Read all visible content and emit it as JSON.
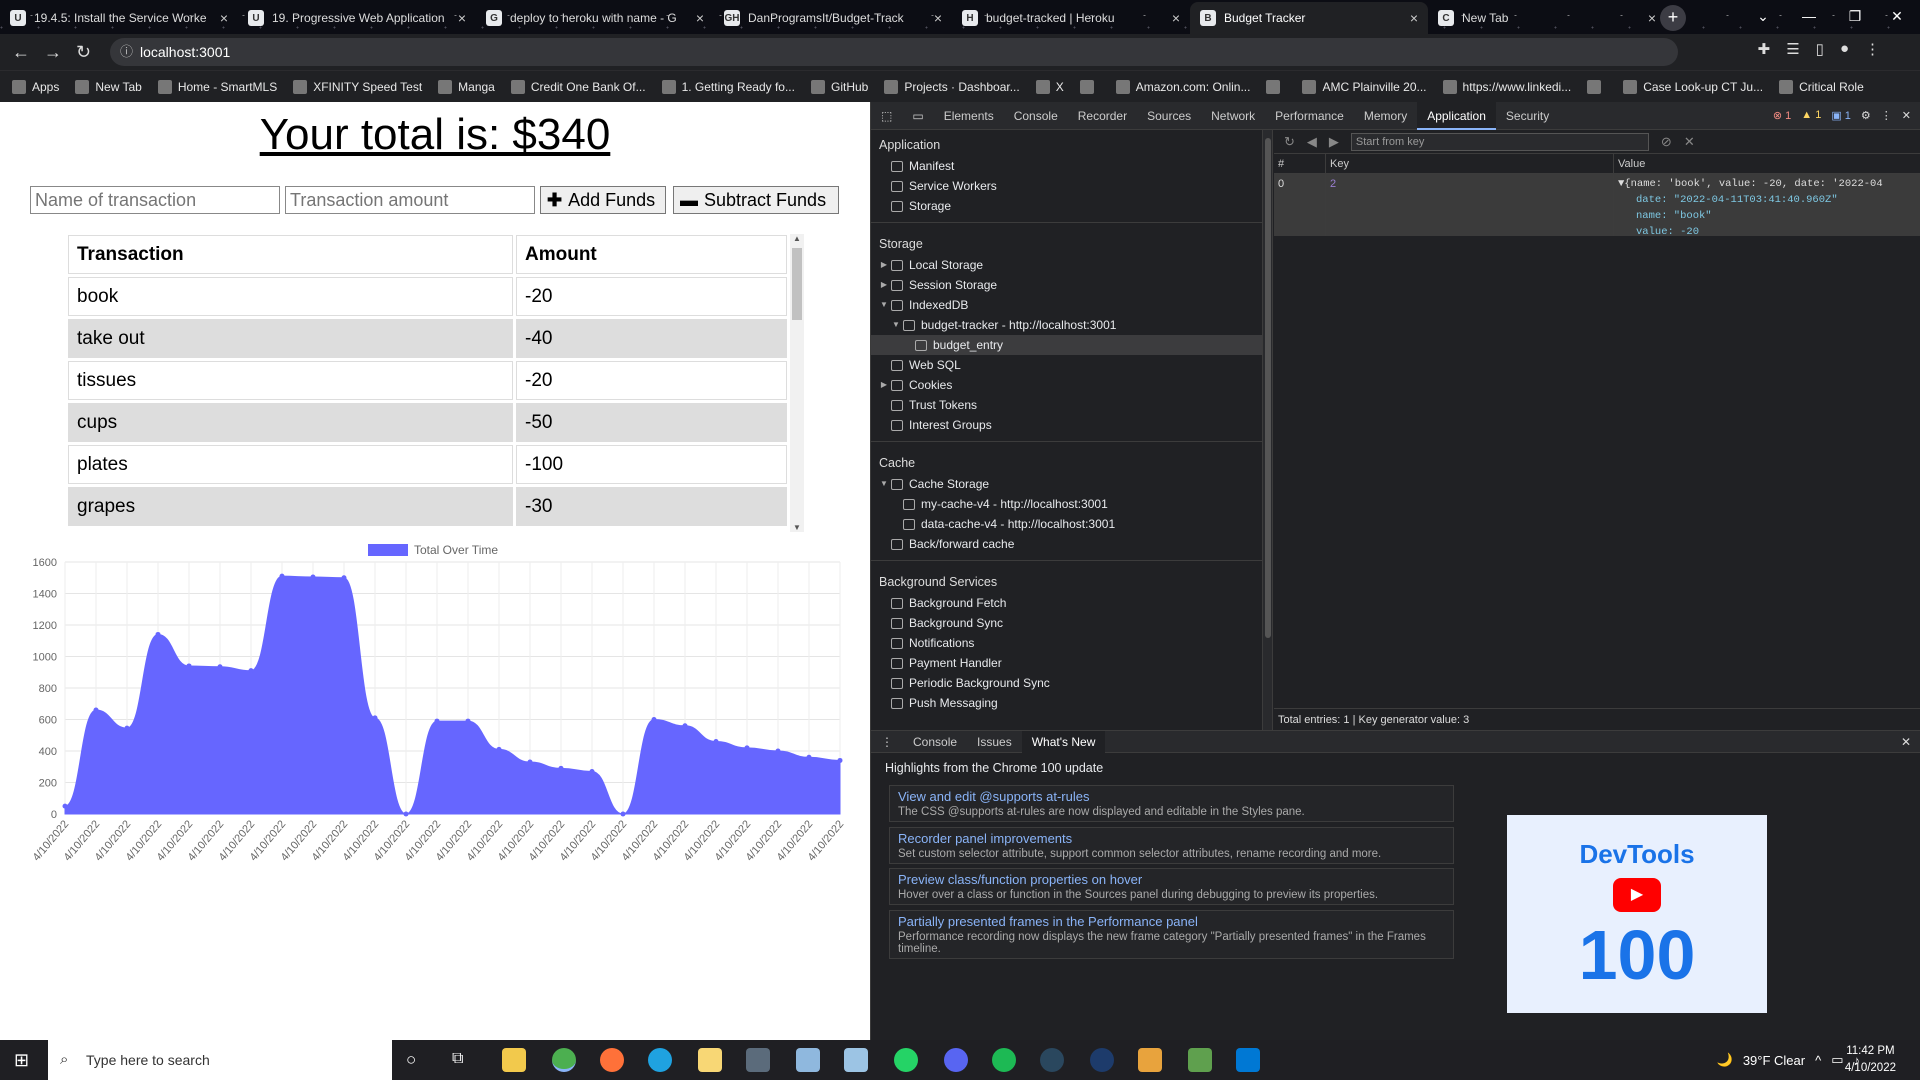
{
  "browser": {
    "tabs": [
      {
        "title": "19.4.5: Install the Service Worke",
        "icon": "U"
      },
      {
        "title": "19. Progressive Web Application",
        "icon": "U"
      },
      {
        "title": "deploy to heroku with name - G",
        "icon": "G"
      },
      {
        "title": "DanProgramsIt/Budget-Track",
        "icon": "GH"
      },
      {
        "title": "budget-tracked | Heroku",
        "icon": "H"
      },
      {
        "title": "Budget Tracker",
        "icon": "B"
      },
      {
        "title": "New Tab",
        "icon": "C"
      }
    ],
    "active_tab": 5,
    "url": "localhost:3001",
    "url_info_icon": "info-icon",
    "bookmarks": [
      "Apps",
      "New Tab",
      "Home - SmartMLS",
      "XFINITY Speed Test",
      "Manga",
      "Credit One Bank Of...",
      "1. Getting Ready fo...",
      "GitHub",
      "Projects · Dashboar...",
      "X",
      "",
      "Amazon.com: Onlin...",
      "",
      "AMC Plainville 20...",
      "https://www.linkedi...",
      "",
      "Case Look-up CT Ju...",
      "Critical Role"
    ]
  },
  "app": {
    "total_text": "Your total is: $340",
    "name_placeholder": "Name of transaction",
    "amount_placeholder": "Transaction amount",
    "add_label": "Add Funds",
    "subtract_label": "Subtract Funds",
    "table_headers": [
      "Transaction",
      "Amount"
    ],
    "transactions": [
      {
        "name": "book",
        "amount": "-20"
      },
      {
        "name": "take out",
        "amount": "-40"
      },
      {
        "name": "tissues",
        "amount": "-20"
      },
      {
        "name": "cups",
        "amount": "-50"
      },
      {
        "name": "plates",
        "amount": "-100"
      },
      {
        "name": "grapes",
        "amount": "-30"
      }
    ]
  },
  "chart_data": {
    "type": "area",
    "series": [
      {
        "name": "Total Over Time",
        "values": [
          50,
          660,
          545,
          1140,
          940,
          935,
          910,
          1510,
          1505,
          1500,
          610,
          0,
          590,
          590,
          410,
          330,
          290,
          270,
          0,
          600,
          560,
          460,
          420,
          400,
          360,
          340
        ]
      }
    ],
    "x": [
      "4/10/2022",
      "4/10/2022",
      "4/10/2022",
      "4/10/2022",
      "4/10/2022",
      "4/10/2022",
      "4/10/2022",
      "4/10/2022",
      "4/10/2022",
      "4/10/2022",
      "4/10/2022",
      "4/10/2022",
      "4/10/2022",
      "4/10/2022",
      "4/10/2022",
      "4/10/2022",
      "4/10/2022",
      "4/10/2022",
      "4/10/2022",
      "4/10/2022",
      "4/10/2022",
      "4/10/2022",
      "4/10/2022",
      "4/10/2022",
      "4/10/2022",
      "4/10/2022"
    ],
    "ylim": [
      0,
      1600
    ],
    "yticks": [
      "1600",
      "1400",
      "1200",
      "1000",
      "800",
      "600",
      "400",
      "200",
      "0"
    ],
    "grid": true,
    "legend_position": "top",
    "fill_color": "#6666ff"
  },
  "devtools": {
    "tabs": [
      "Elements",
      "Console",
      "Recorder",
      "Sources",
      "Network",
      "Performance",
      "Memory",
      "Application",
      "Security"
    ],
    "selected_tab": "Application",
    "badges": {
      "errors": "1",
      "warnings": "1",
      "messages": "1"
    },
    "sections": [
      {
        "title": "Application",
        "items": [
          {
            "label": "Manifest",
            "level": 0,
            "twisty": ""
          },
          {
            "label": "Service Workers",
            "level": 0,
            "twisty": ""
          },
          {
            "label": "Storage",
            "level": 0,
            "twisty": ""
          }
        ]
      },
      {
        "title": "Storage",
        "items": [
          {
            "label": "Local Storage",
            "level": 0,
            "twisty": "▶"
          },
          {
            "label": "Session Storage",
            "level": 0,
            "twisty": "▶"
          },
          {
            "label": "IndexedDB",
            "level": 0,
            "twisty": "▼"
          },
          {
            "label": "budget-tracker - http://localhost:3001",
            "level": 1,
            "twisty": "▼"
          },
          {
            "label": "budget_entry",
            "level": 2,
            "twisty": "",
            "selected": true
          },
          {
            "label": "Web SQL",
            "level": 0,
            "twisty": ""
          },
          {
            "label": "Cookies",
            "level": 0,
            "twisty": "▶"
          },
          {
            "label": "Trust Tokens",
            "level": 0,
            "twisty": ""
          },
          {
            "label": "Interest Groups",
            "level": 0,
            "twisty": ""
          }
        ]
      },
      {
        "title": "Cache",
        "items": [
          {
            "label": "Cache Storage",
            "level": 0,
            "twisty": "▼"
          },
          {
            "label": "my-cache-v4 - http://localhost:3001",
            "level": 1,
            "twisty": ""
          },
          {
            "label": "data-cache-v4 - http://localhost:3001",
            "level": 1,
            "twisty": ""
          },
          {
            "label": "Back/forward cache",
            "level": 0,
            "twisty": ""
          }
        ]
      },
      {
        "title": "Background Services",
        "items": [
          {
            "label": "Background Fetch",
            "level": 0,
            "twisty": ""
          },
          {
            "label": "Background Sync",
            "level": 0,
            "twisty": ""
          },
          {
            "label": "Notifications",
            "level": 0,
            "twisty": ""
          },
          {
            "label": "Payment Handler",
            "level": 0,
            "twisty": ""
          },
          {
            "label": "Periodic Background Sync",
            "level": 0,
            "twisty": ""
          },
          {
            "label": "Push Messaging",
            "level": 0,
            "twisty": ""
          }
        ]
      }
    ],
    "db": {
      "start_placeholder": "Start from key",
      "headers": [
        "#",
        "Key",
        "Value"
      ],
      "row": {
        "index": "0",
        "key": "2",
        "summary": "▼{name: 'book', value: -20, date: '2022-04",
        "date_line": "date: \"2022-04-11T03:41:40.960Z\"",
        "name_line": "name: \"book\"",
        "value_line": "value: -20"
      },
      "footer": "Total entries: 1  |  Key generator value: 3"
    },
    "drawer": {
      "tabs": [
        "Console",
        "Issues",
        "What's New"
      ],
      "heading": "Highlights from the Chrome 100 update",
      "cards": [
        {
          "title": "View and edit @supports at-rules",
          "desc": "The CSS @supports at-rules are now displayed and editable in the Styles pane."
        },
        {
          "title": "Recorder panel improvements",
          "desc": "Set custom selector attribute, support common selector attributes, rename recording and more."
        },
        {
          "title": "Preview class/function properties on hover",
          "desc": "Hover over a class or function in the Sources panel during debugging to preview its properties."
        },
        {
          "title": "Partially presented frames in the Performance panel",
          "desc": "Performance recording now displays the new frame category \"Partially presented frames\" in the Frames timeline."
        }
      ],
      "promo_title": "DevTools",
      "promo_number": "100"
    }
  },
  "taskbar": {
    "search_placeholder": "Type here to search",
    "weather": "39°F  Clear",
    "time": "11:42 PM",
    "date": "4/10/2022"
  }
}
